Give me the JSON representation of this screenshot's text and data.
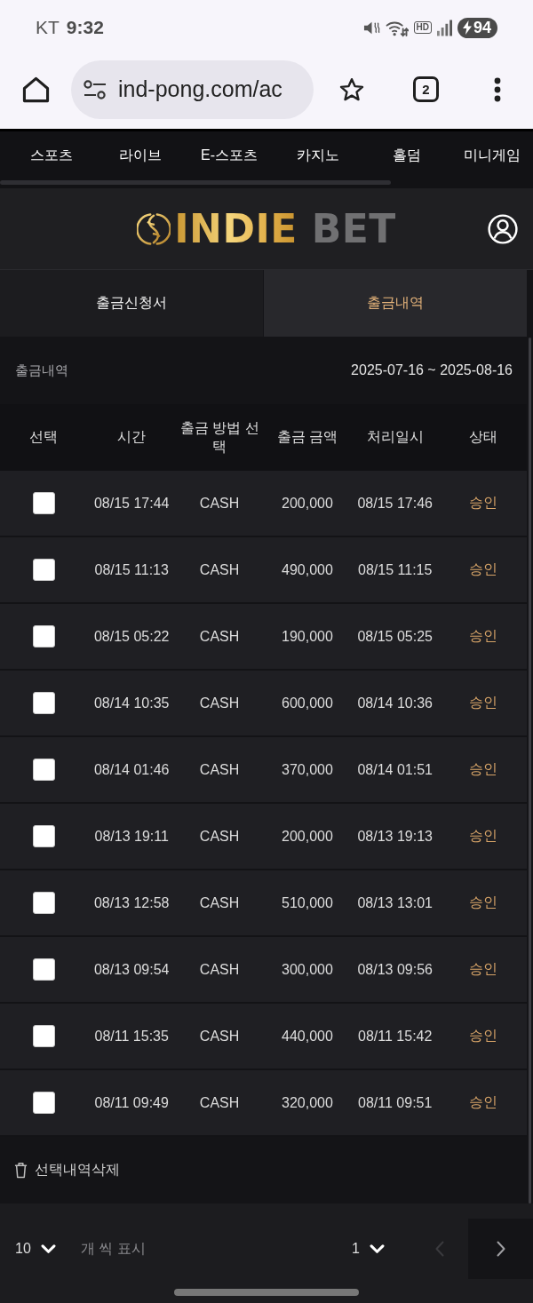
{
  "status_bar": {
    "carrier": "KT",
    "time": "9:32",
    "hd_label": "HD",
    "battery": "94"
  },
  "browser": {
    "url": "ind-pong.com/ac",
    "tab_count": "2"
  },
  "nav": {
    "items": [
      "스포츠",
      "라이브",
      "E-스포츠",
      "카지노",
      "홀덤",
      "미니게임"
    ]
  },
  "header": {
    "logo": {
      "words": [
        "INDIE",
        "BET"
      ]
    }
  },
  "tabs": [
    {
      "label": "출금신청서",
      "selected": false
    },
    {
      "label": "출금내역",
      "selected": true
    }
  ],
  "history": {
    "title": "출금내역",
    "date_range": "2025-07-16 ~ 2025-08-16"
  },
  "table": {
    "columns": [
      "선택",
      "시간",
      "출금 방법 선택",
      "출금 금액",
      "처리일시",
      "상태"
    ],
    "rows": [
      {
        "checked": false,
        "time": "08/15 17:44",
        "method": "CASH",
        "amount": "200,000",
        "processed": "08/15 17:46",
        "status": "승인"
      },
      {
        "checked": false,
        "time": "08/15 11:13",
        "method": "CASH",
        "amount": "490,000",
        "processed": "08/15 11:15",
        "status": "승인"
      },
      {
        "checked": false,
        "time": "08/15 05:22",
        "method": "CASH",
        "amount": "190,000",
        "processed": "08/15 05:25",
        "status": "승인"
      },
      {
        "checked": false,
        "time": "08/14 10:35",
        "method": "CASH",
        "amount": "600,000",
        "processed": "08/14 10:36",
        "status": "승인"
      },
      {
        "checked": false,
        "time": "08/14 01:46",
        "method": "CASH",
        "amount": "370,000",
        "processed": "08/14 01:51",
        "status": "승인"
      },
      {
        "checked": false,
        "time": "08/13 19:11",
        "method": "CASH",
        "amount": "200,000",
        "processed": "08/13 19:13",
        "status": "승인"
      },
      {
        "checked": false,
        "time": "08/13 12:58",
        "method": "CASH",
        "amount": "510,000",
        "processed": "08/13 13:01",
        "status": "승인"
      },
      {
        "checked": false,
        "time": "08/13 09:54",
        "method": "CASH",
        "amount": "300,000",
        "processed": "08/13 09:56",
        "status": "승인"
      },
      {
        "checked": false,
        "time": "08/11 15:35",
        "method": "CASH",
        "amount": "440,000",
        "processed": "08/11 15:42",
        "status": "승인"
      },
      {
        "checked": false,
        "time": "08/11 09:49",
        "method": "CASH",
        "amount": "320,000",
        "processed": "08/11 09:51",
        "status": "승인"
      }
    ]
  },
  "delete_button": {
    "label": "선택내역삭제"
  },
  "pagination": {
    "page_size": "10",
    "page_size_label": "개 씩 표시",
    "page": "1",
    "prev": {
      "disabled": true
    },
    "next": {
      "disabled": false
    }
  }
}
